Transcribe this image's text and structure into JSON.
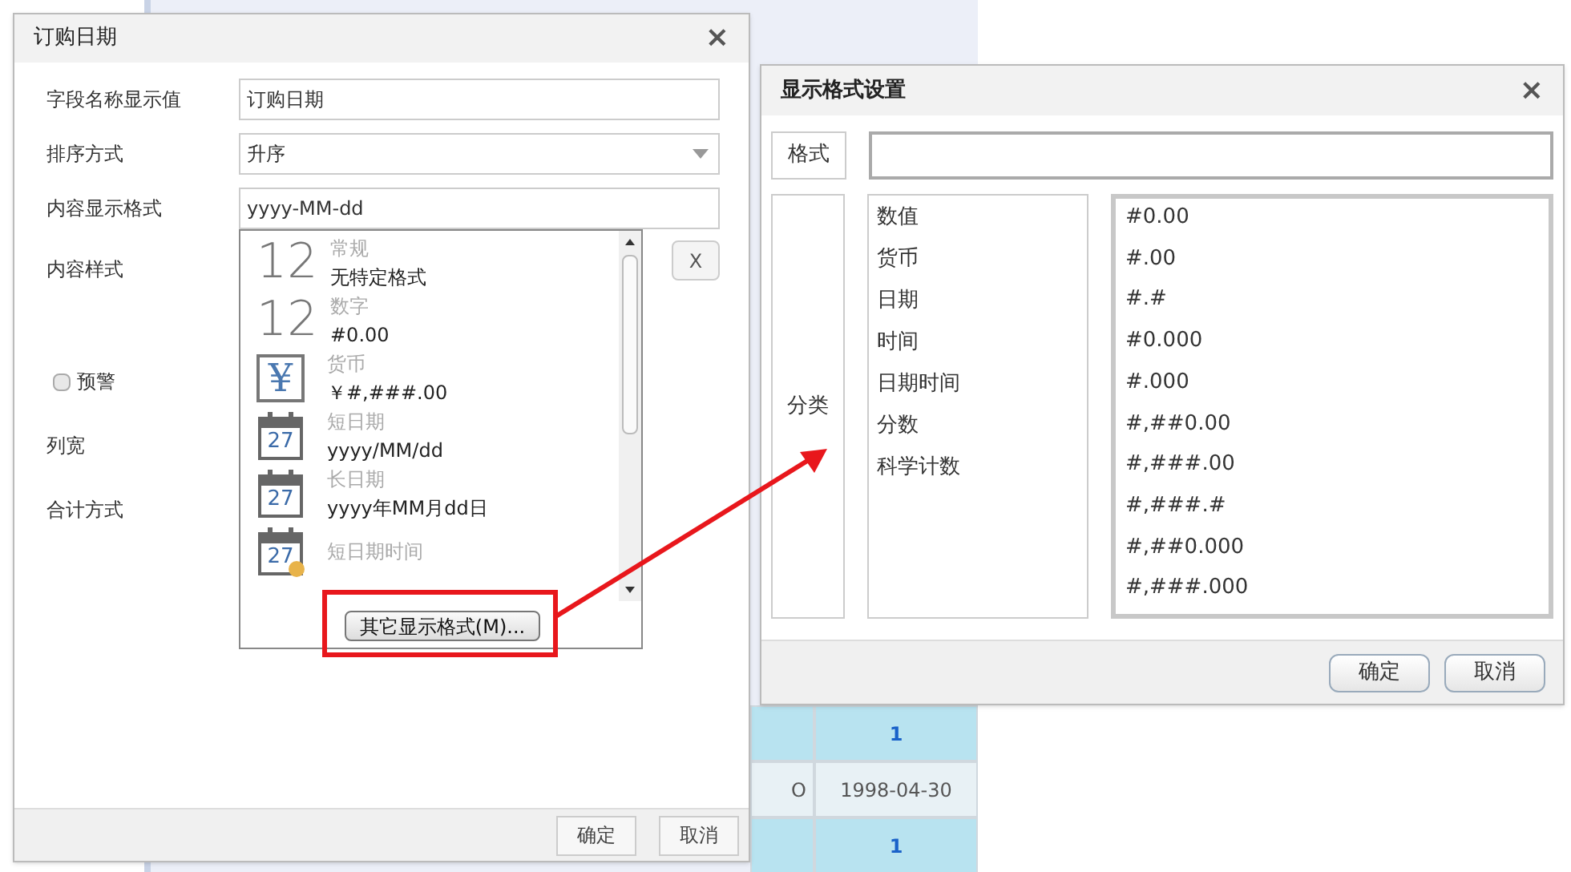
{
  "background_table": {
    "rows": [
      {
        "highlight": true,
        "cells": [
          "",
          "1"
        ]
      },
      {
        "highlight": false,
        "cells": [
          "O",
          "1998-04-30"
        ]
      },
      {
        "highlight": true,
        "cells": [
          "",
          "1"
        ]
      }
    ]
  },
  "field_dialog": {
    "title": "订购日期",
    "close": "×",
    "fields": [
      {
        "label": "字段名称显示值",
        "kind": "text",
        "value": "订购日期"
      },
      {
        "label": "排序方式",
        "kind": "select",
        "value": "升序"
      },
      {
        "label": "内容显示格式",
        "kind": "text",
        "value": "yyyy-MM-dd"
      }
    ],
    "content_style": {
      "label": "内容样式",
      "clear_button": "X"
    },
    "warning": {
      "label": "预警",
      "checked": false
    },
    "column_width": {
      "label": "列宽"
    },
    "total_mode": {
      "label": "合计方式"
    },
    "format_popup": {
      "items": [
        {
          "kind": "number",
          "icon_text": "12",
          "category": "常规",
          "sample": "无特定格式"
        },
        {
          "kind": "number",
          "icon_text": "12",
          "category": "数字",
          "sample": "#0.00"
        },
        {
          "kind": "currency",
          "icon_text": "¥",
          "category": "货币",
          "sample": "￥#,###.00"
        },
        {
          "kind": "calendar",
          "icon_text": "27",
          "category": "短日期",
          "sample": "yyyy/MM/dd"
        },
        {
          "kind": "calendar",
          "icon_text": "27",
          "category": "长日期",
          "sample": "yyyy年MM月dd日"
        },
        {
          "kind": "datetime",
          "icon_text": "27",
          "category": "短日期时间"
        }
      ],
      "more_button": "其它显示格式(M)..."
    },
    "buttons": [
      "确定",
      "取消"
    ]
  },
  "format_dialog": {
    "title": "显示格式设置",
    "close": "×",
    "format_label": "格式",
    "category_label": "分类",
    "categories": [
      "数值",
      "货币",
      "日期",
      "时间",
      "日期时间",
      "分数",
      "科学计数"
    ],
    "formats": [
      "#0.00",
      "#.00",
      "#.#",
      "#0.000",
      "#.000",
      "#,##0.00",
      "#,###.00",
      "#,###.#",
      "#,##0.000",
      "#,###.000"
    ],
    "buttons": [
      "确定",
      "取消"
    ]
  }
}
